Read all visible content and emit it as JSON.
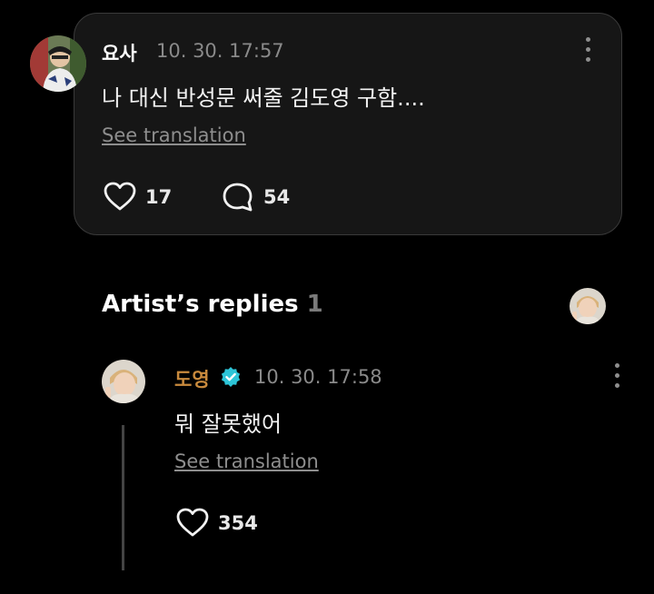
{
  "post": {
    "username": "요사",
    "timestamp": "10. 30. 17:57",
    "text": "나 대신 반성문 써줄 김도영 구함....",
    "see_translation": "See translation",
    "likes": "17",
    "comments": "54",
    "icons": {
      "like": "heart-icon",
      "comment": "speech-bubble-icon",
      "more": "more-vertical-icon"
    }
  },
  "replies_section": {
    "title": "Artist’s replies",
    "count": "1"
  },
  "reply": {
    "username": "도영",
    "username_color": "#c98a3d",
    "verified_color": "#2dc5d8",
    "timestamp": "10. 30. 17:58",
    "text": "뭐 잘못했어",
    "see_translation": "See translation",
    "likes": "354",
    "icons": {
      "like": "heart-icon",
      "verified": "verified-badge-icon",
      "more": "more-vertical-icon"
    }
  }
}
